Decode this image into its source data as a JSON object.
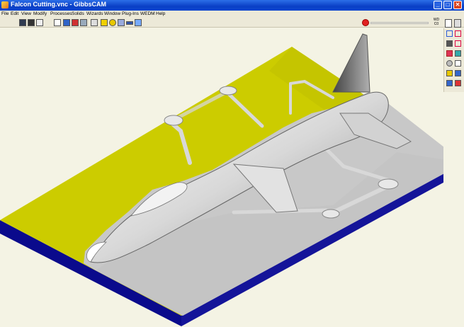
{
  "window": {
    "title": "Falcon Cutting.vnc - GibbsCAM",
    "buttons": {
      "minimize": "_",
      "maximize": "□",
      "close": "✕"
    }
  },
  "menu": [
    "File",
    "Edit",
    "View",
    "Modify",
    "Processes",
    "Solids",
    "Wizards",
    "Window",
    "Plug-Ins",
    "WEDM",
    "Help"
  ],
  "toolbar": {
    "left_icons": [
      "grid-view-icon",
      "solid-view-icon",
      "box-view-icon",
      "point-icon",
      "line-icon",
      "color-icon",
      "mesh-icon",
      "blank-icon",
      "cube-icon",
      "sphere-icon",
      "cylinder-icon",
      "flat-icon",
      "tool-icon"
    ],
    "stop_icon": "stop-icon",
    "progress_fraction": 0,
    "readout": [
      "WD",
      "C0"
    ]
  },
  "side_palette": [
    "select-icon",
    "transform-icon",
    "tool-icon",
    "measure-icon",
    "chart-icon",
    "surface-icon",
    "render-icon",
    "shade-icon",
    "xyz-icon",
    "info-icon",
    "hidden-icon",
    "clip-icon"
  ],
  "viewport": {
    "colors": {
      "background": "#f4f3e4",
      "stock_top": "#cccc00",
      "stock_side": "#0a0a8c",
      "cut_floor": "#c8c8c8",
      "part": "#e6e6e6"
    }
  }
}
